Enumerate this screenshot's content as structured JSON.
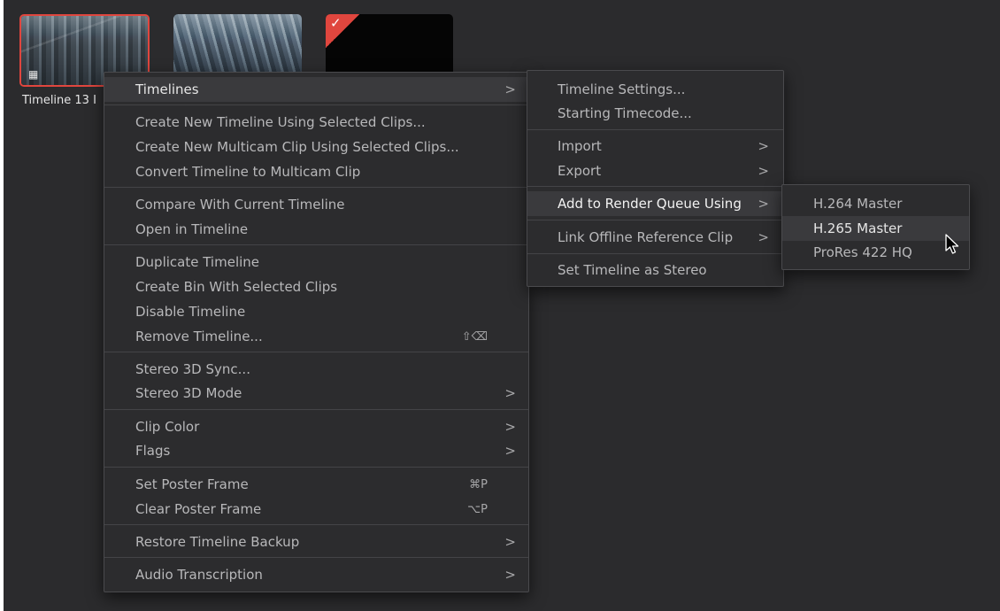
{
  "thumbnails": [
    {
      "label": "Timeline 13 I"
    },
    {
      "label": ""
    },
    {
      "label": ""
    }
  ],
  "main_menu": {
    "timelines": "Timelines",
    "create_new_timeline": "Create New Timeline Using Selected Clips...",
    "create_multicam": "Create New Multicam Clip Using Selected Clips...",
    "convert_multicam": "Convert Timeline to Multicam Clip",
    "compare": "Compare With Current Timeline",
    "open_in_timeline": "Open in Timeline",
    "duplicate": "Duplicate Timeline",
    "create_bin": "Create Bin With Selected Clips",
    "disable": "Disable Timeline",
    "remove": "Remove Timeline...",
    "remove_shortcut": "⇧⌫",
    "stereo_sync": "Stereo 3D Sync...",
    "stereo_mode": "Stereo 3D Mode",
    "clip_color": "Clip Color",
    "flags": "Flags",
    "set_poster": "Set Poster Frame",
    "set_poster_shortcut": "⌘P",
    "clear_poster": "Clear Poster Frame",
    "clear_poster_shortcut": "⌥P",
    "restore_backup": "Restore Timeline Backup",
    "audio_transcription": "Audio Transcription",
    "arrow": ">"
  },
  "timelines_submenu": {
    "timeline_settings": "Timeline Settings...",
    "starting_timecode": "Starting Timecode...",
    "import": "Import",
    "export": "Export",
    "add_render_queue": "Add to Render Queue Using",
    "link_offline": "Link Offline Reference Clip",
    "set_stereo": "Set Timeline as Stereo"
  },
  "render_submenu": {
    "h264": "H.264 Master",
    "h265": "H.265 Master",
    "prores": "ProRes 422 HQ"
  },
  "colors": {
    "panel_bg": "#2b2b2d",
    "menu_bg": "#2c2c2e",
    "highlight": "#3a3a3d",
    "selection_red": "#e0463e"
  },
  "icons": [
    "timeline-icon",
    "flag-check-icon",
    "chevron-right-icon",
    "mouse-pointer-icon"
  ]
}
